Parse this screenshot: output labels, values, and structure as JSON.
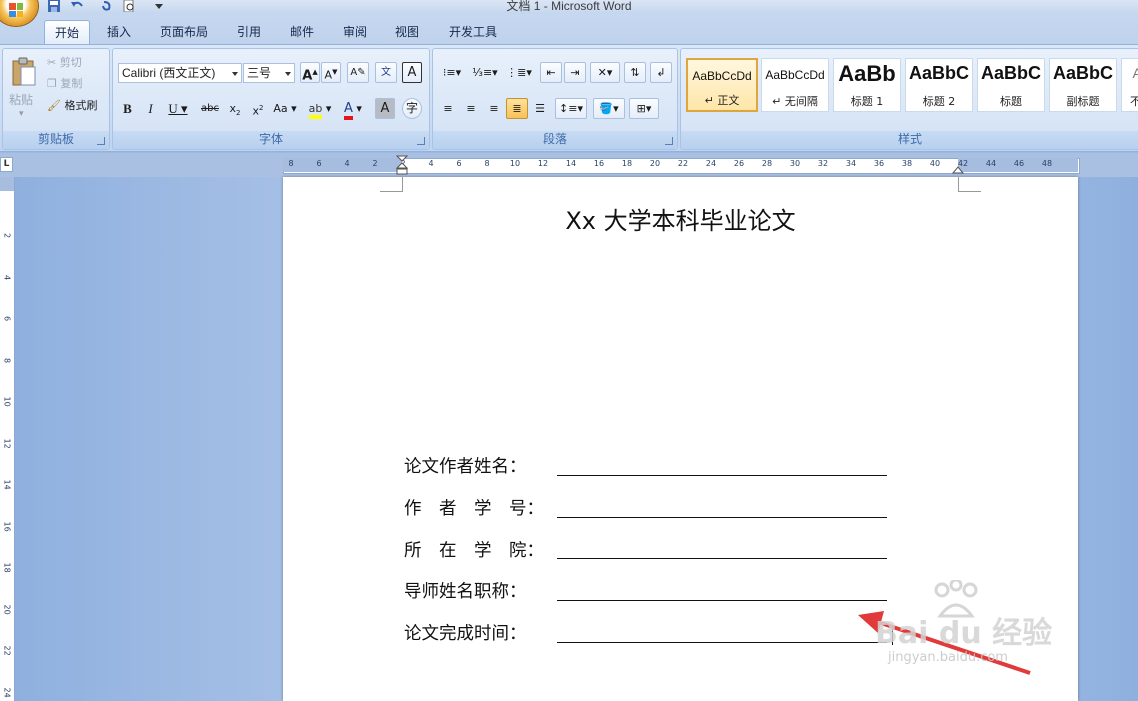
{
  "window": {
    "title": "文档 1 - Microsoft Word"
  },
  "tabs": [
    "开始",
    "插入",
    "页面布局",
    "引用",
    "邮件",
    "审阅",
    "视图",
    "开发工具"
  ],
  "clipboard": {
    "paste": "粘贴",
    "cut": "剪切",
    "copy": "复制",
    "format_painter": "格式刷",
    "group": "剪贴板"
  },
  "font": {
    "name": "Calibri (西文正文)",
    "size": "三号",
    "group": "字体"
  },
  "paragraph": {
    "group": "段落"
  },
  "styles": {
    "group": "样式",
    "items": [
      {
        "sample": "AaBbCcDd",
        "name": "↵ 正文"
      },
      {
        "sample": "AaBbCcDd",
        "name": "↵ 无间隔"
      },
      {
        "sample": "AaBb",
        "name": "标题 1"
      },
      {
        "sample": "AaBbC",
        "name": "标题 2"
      },
      {
        "sample": "AaBbC",
        "name": "标题"
      },
      {
        "sample": "AaBbC",
        "name": "副标题"
      },
      {
        "sample": "Aa",
        "name": "不明"
      }
    ]
  },
  "ruler": {
    "h_ticks": [
      "8",
      "6",
      "4",
      "2",
      "2",
      "4",
      "6",
      "8",
      "10",
      "12",
      "14",
      "16",
      "18",
      "20",
      "22",
      "24",
      "26",
      "28",
      "30",
      "32",
      "34",
      "36",
      "38",
      "40",
      "42",
      "44",
      "46",
      "48"
    ],
    "v_ticks": [
      "2",
      "4",
      "6",
      "8",
      "10",
      "12",
      "14",
      "16",
      "18",
      "20",
      "22",
      "24"
    ],
    "corner": "L"
  },
  "document": {
    "title": "Xx 大学本科毕业论文",
    "fields": [
      {
        "label": "论文作者姓名："
      },
      {
        "label": "作　者　学　号："
      },
      {
        "label": "所　在　学　院："
      },
      {
        "label": "导师姓名职称："
      },
      {
        "label": "论文完成时间："
      }
    ]
  },
  "watermark": {
    "brand": "Bai du 经验",
    "url": "jingyan.baidu.com"
  },
  "colors": {
    "ribbon": "#cfdef3",
    "page": "#ffffff",
    "arrow": "#e03a3a",
    "font_color": "#e8141b",
    "highlight": "#ffff00"
  }
}
